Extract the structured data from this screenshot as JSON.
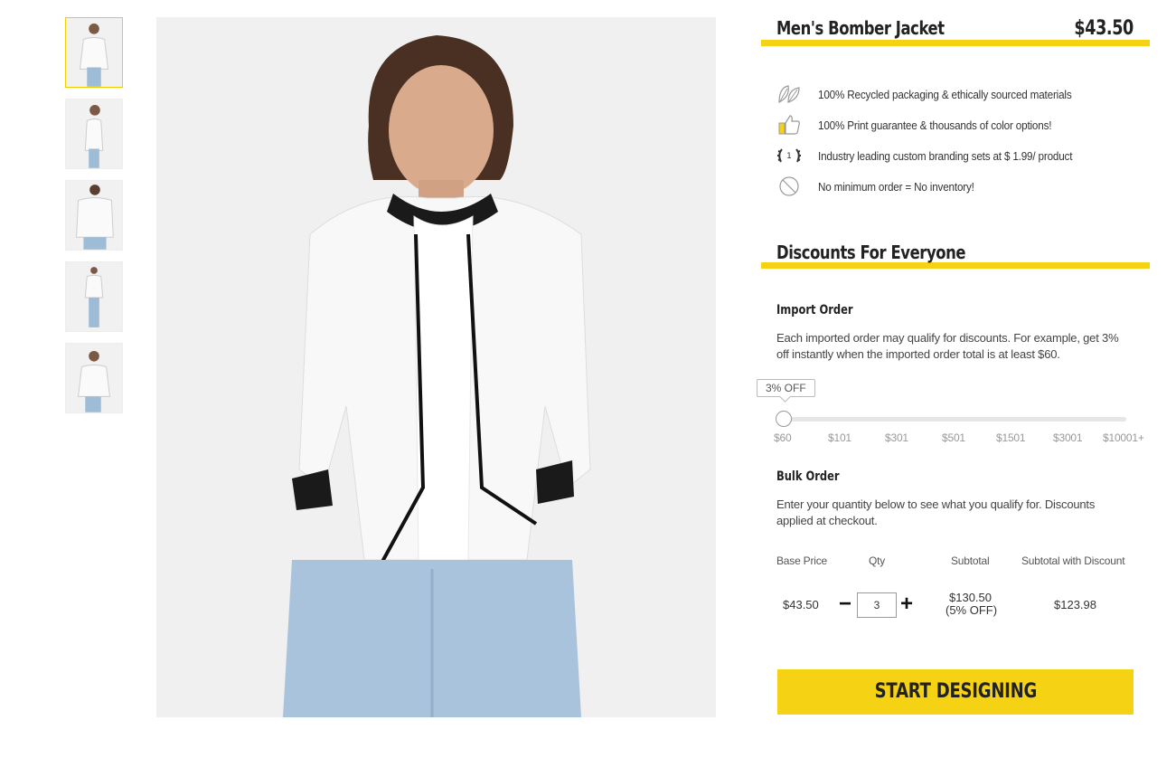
{
  "product": {
    "title": "Men's Bomber Jacket",
    "price": "$43.50"
  },
  "features": [
    {
      "icon": "leaf-icon",
      "text": "100% Recycled packaging & ethically sourced materials"
    },
    {
      "icon": "thumbs-up-icon",
      "text": "100% Print guarantee & thousands of color options!"
    },
    {
      "icon": "laurel-award-icon",
      "text": "Industry leading custom branding sets at $ 1.99/ product"
    },
    {
      "icon": "no-sign-icon",
      "text": "No minimum order = No inventory!"
    }
  ],
  "discounts": {
    "title": "Discounts For Everyone",
    "import_order": {
      "heading": "Import Order",
      "description": "Each imported order may qualify for discounts. For example, get 3% off instantly when the imported order total is at least $60.",
      "tooltip": "3% OFF",
      "ticks": [
        "$60",
        "$101",
        "$301",
        "$501",
        "$1501",
        "$3001",
        "$10001+"
      ],
      "selected_index": 0
    },
    "bulk_order": {
      "heading": "Bulk Order",
      "description": "Enter your quantity below to see what you qualify for. Discounts applied at checkout.",
      "headers": {
        "base_price": "Base Price",
        "qty": "Qty",
        "subtotal": "Subtotal",
        "subtotal_discount": "Subtotal with Discount"
      },
      "values": {
        "base_price": "$43.50",
        "qty": "3",
        "subtotal": "$130.50",
        "subtotal_note": "(5% OFF)",
        "subtotal_discount": "$123.98"
      }
    }
  },
  "cta_label": "START DESIGNING",
  "colors": {
    "accent": "#f6d215"
  }
}
